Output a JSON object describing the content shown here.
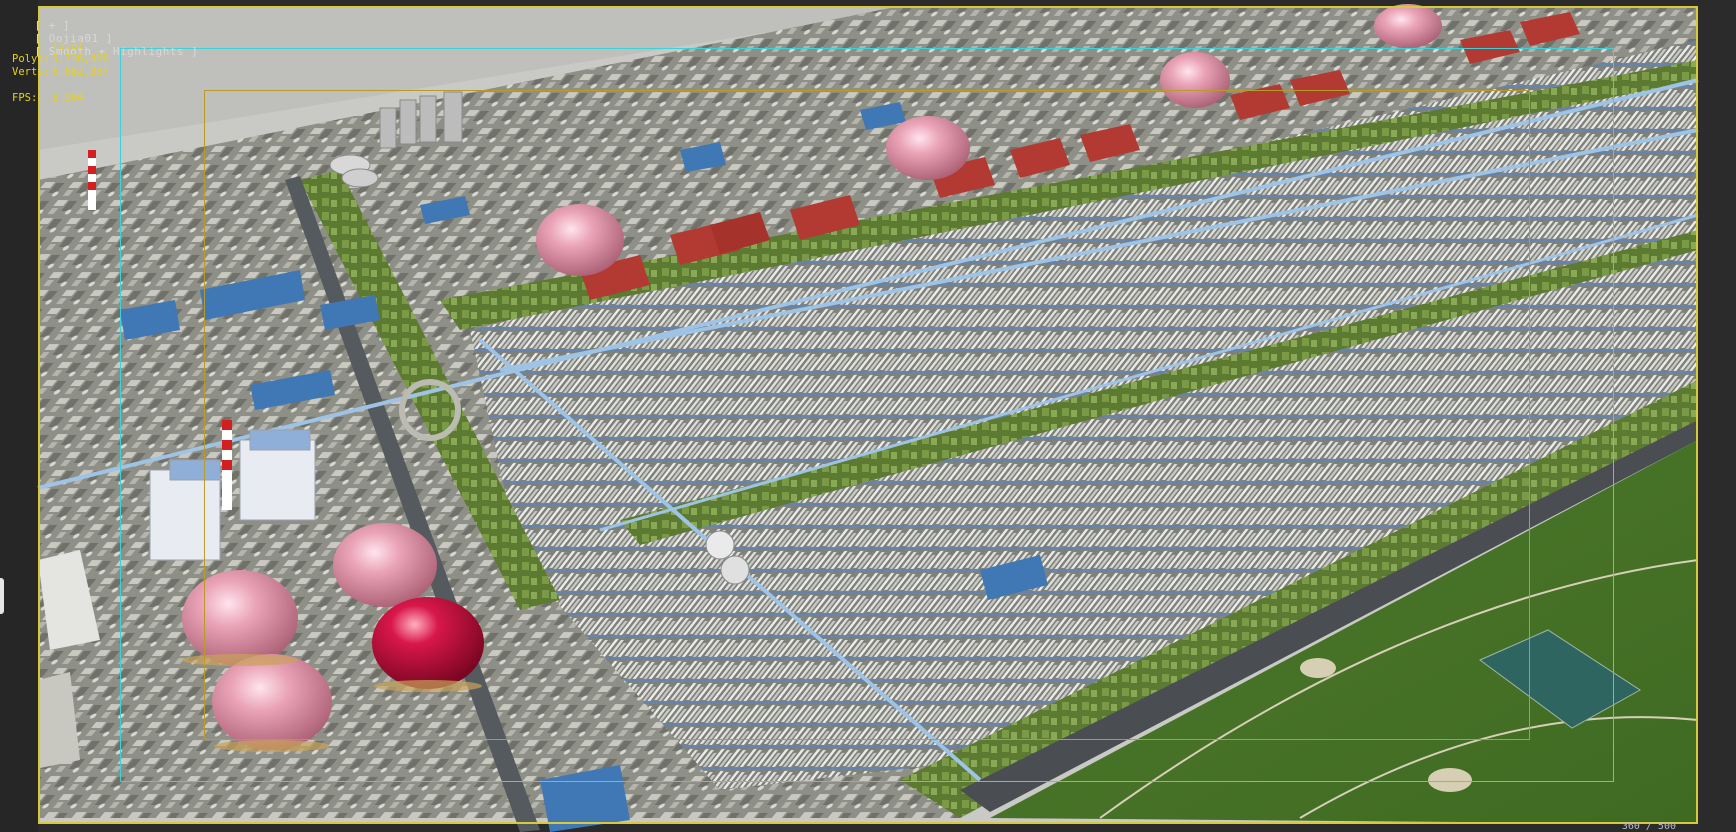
{
  "viewport": {
    "label_segments": [
      "[ + ]",
      "[ Oojia01 ]",
      "[ Smooth + Highlights ]"
    ],
    "stats": {
      "header": "Total",
      "rows": [
        {
          "key": "Polys:",
          "value": "5,736,468"
        },
        {
          "key": "Verts:",
          "value": "6,682,387"
        },
        {
          "key": "FPS:",
          "value": "3.904"
        }
      ]
    },
    "frame_counter": "360 / 500"
  },
  "colors": {
    "grass": "#6f8a3a",
    "pavement": "#9a9a92",
    "road": "#5a5f63",
    "pipe": "#7fb0d8",
    "roof_blue": "#3f78b4",
    "roof_red": "#b23a32",
    "dome_pink": "#d98aa0",
    "dome_red": "#c4103a",
    "sky": "#c8c8c8",
    "active_border": "#d7c83c",
    "safe_frame_outer": "#3fd0d8",
    "safe_frame_inner": "#b99a2d"
  },
  "icons": [
    "viewport-menu-icon"
  ]
}
